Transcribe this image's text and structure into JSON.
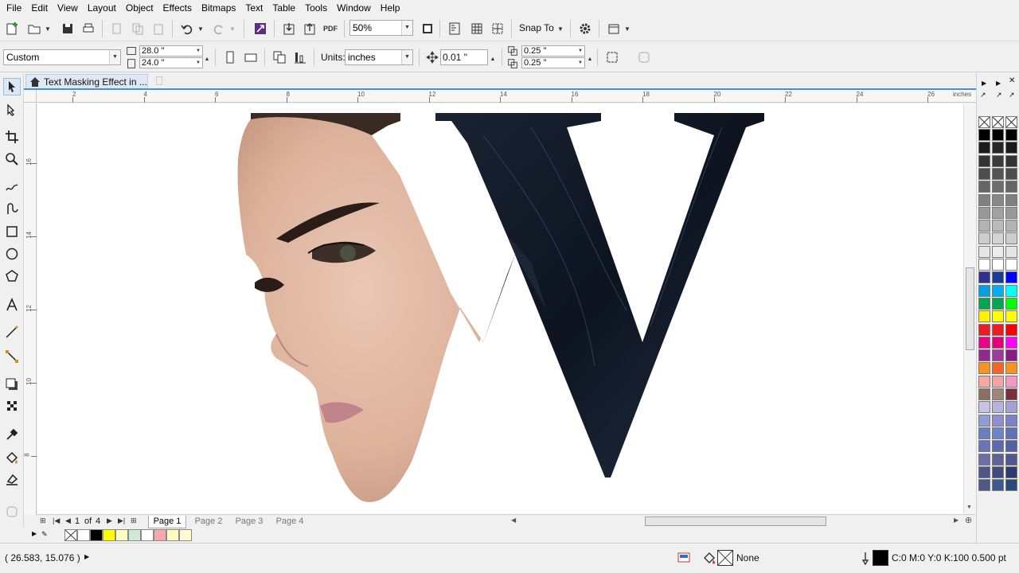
{
  "menu": [
    "File",
    "Edit",
    "View",
    "Layout",
    "Object",
    "Effects",
    "Bitmaps",
    "Text",
    "Table",
    "Tools",
    "Window",
    "Help"
  ],
  "toolbar": {
    "zoom_value": "50%",
    "snap_label": "Snap To"
  },
  "property_bar": {
    "page_preset": "Custom",
    "page_width": "28.0 \"",
    "page_height": "24.0 \"",
    "units_label": "Units:",
    "units_value": "inches",
    "nudge_value": "0.01 \"",
    "dup_x": "0.25 \"",
    "dup_y": "0.25 \""
  },
  "document": {
    "tab_title": "Text Masking Effect in ...",
    "artwork_letter": "W"
  },
  "rulers": {
    "unit": "inches",
    "h_ticks": [
      "2",
      "4",
      "6",
      "8",
      "10",
      "12",
      "14",
      "16",
      "18",
      "20",
      "22",
      "24",
      "26"
    ],
    "v_ticks": [
      "16",
      "14",
      "12",
      "10",
      "8"
    ]
  },
  "pages": {
    "current": "1",
    "of_label": "of",
    "total": "4",
    "tabs": [
      "Page 1",
      "Page 2",
      "Page 3",
      "Page 4"
    ]
  },
  "document_palette": [
    "#ffffff",
    "#000000",
    "#ffff00",
    "#fffbc2",
    "#cfe9d3",
    "#ffffff",
    "#f7a8a8",
    "#fffbc2",
    "#fffbd0"
  ],
  "status": {
    "coords": "( 26.583, 15.076 )",
    "fill_label": "None",
    "outline_label": "C:0 M:0 Y:0 K:100  0.500 pt"
  },
  "colors": {
    "accent": "#4a90d9",
    "hair": "#0f1825",
    "skin": "#e2b9a4"
  },
  "palette_colors": [
    "#000000",
    "#000000",
    "#000000",
    "#1a1a1a",
    "#262626",
    "#1a1a1a",
    "#333333",
    "#3a3a3a",
    "#333333",
    "#4d4d4d",
    "#555555",
    "#4d4d4d",
    "#666666",
    "#6e6e6e",
    "#666666",
    "#808080",
    "#888888",
    "#808080",
    "#999999",
    "#a1a1a1",
    "#999999",
    "#b3b3b3",
    "#bbbbbb",
    "#b3b3b3",
    "#cccccc",
    "#d4d4d4",
    "#cccccc",
    "#e6e6e6",
    "#ececec",
    "#e6e6e6",
    "#ffffff",
    "#ffffff",
    "#ffffff",
    "#2e3192",
    "#1b3a9e",
    "#0000ff",
    "#00a0e3",
    "#00aeef",
    "#00ffff",
    "#00a651",
    "#00a651",
    "#00ff00",
    "#fff200",
    "#ffff00",
    "#ffff00",
    "#ed1c24",
    "#ee1d24",
    "#ff0000",
    "#ec008c",
    "#e4007c",
    "#ff00ff",
    "#92278f",
    "#9e3a9e",
    "#8b1a89",
    "#f7941d",
    "#f26522",
    "#f7941d",
    "#f9a7a0",
    "#f4a3a3",
    "#f49ac1",
    "#8c6d62",
    "#a0847a",
    "#7b2f3a",
    "#c7c3e6",
    "#b6b3dd",
    "#a5a0d6",
    "#8e9dd3",
    "#8f8fd0",
    "#7a81c7",
    "#6a7fc1",
    "#6d84c8",
    "#5f6fb8",
    "#6b74b8",
    "#5e69ad",
    "#555fa3",
    "#6c6ea8",
    "#5f6299",
    "#52588d",
    "#4b5689",
    "#3f4b7c",
    "#2c3b6f",
    "#4a5a83",
    "#3c5a8c",
    "#2a4a7c"
  ]
}
